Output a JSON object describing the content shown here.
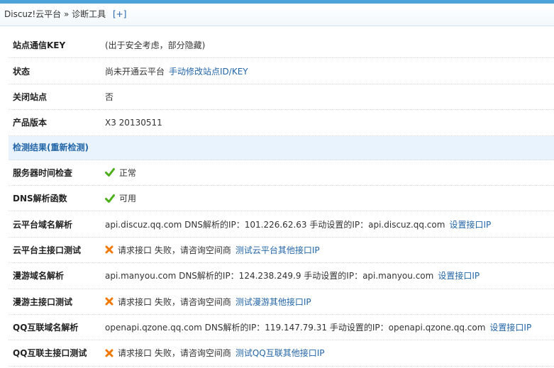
{
  "header": {
    "breadcrumb": "Discuz!云平台 » 诊断工具",
    "add": "[+]"
  },
  "rows_top": [
    {
      "key": "站点通信KEY",
      "value": "(出于安全考虑，部分隐藏)",
      "link": ""
    },
    {
      "key": "状态",
      "value": "尚未开通云平台",
      "link": "手动修改站点ID/KEY"
    },
    {
      "key": "关闭站点",
      "value": "否",
      "link": ""
    },
    {
      "key": "产品版本",
      "value": "X3 20130511",
      "link": ""
    }
  ],
  "section": {
    "title": "检测结果(重新检测)"
  },
  "checks": [
    {
      "key": "服务器时间检查",
      "status": "ok",
      "value": "正常",
      "link": ""
    },
    {
      "key": "DNS解析函数",
      "status": "ok",
      "value": "可用",
      "link": ""
    },
    {
      "key": "云平台域名解析",
      "status": "",
      "value": "api.discuz.qq.com DNS解析的IP：101.226.62.63 手动设置的IP：api.discuz.qq.com",
      "link": "设置接口IP"
    },
    {
      "key": "云平台主接口测试",
      "status": "error",
      "value": "请求接口 失败，请咨询空间商",
      "link": "测试云平台其他接口IP"
    },
    {
      "key": "漫游域名解析",
      "status": "",
      "value": "api.manyou.com DNS解析的IP：124.238.249.9 手动设置的IP：api.manyou.com",
      "link": "设置接口IP"
    },
    {
      "key": "漫游主接口测试",
      "status": "error",
      "value": "请求接口 失败，请咨询空间商",
      "link": "测试漫游其他接口IP"
    },
    {
      "key": "QQ互联域名解析",
      "status": "",
      "value": "openapi.qzone.qq.com DNS解析的IP：119.147.79.31 手动设置的IP：openapi.qzone.qq.com",
      "link": "设置接口IP"
    },
    {
      "key": "QQ互联主接口测试",
      "status": "error",
      "value": "请求接口 失败，请咨询空间商",
      "link": "测试QQ互联其他接口IP"
    }
  ],
  "icons": {
    "ok": "check-icon",
    "error": "cross-icon"
  },
  "colors": {
    "link": "#2366a8",
    "section_bg": "#e8f3fd",
    "ok": "#4caf1a",
    "error": "#f07800",
    "topbar": "#4aa3d8"
  }
}
